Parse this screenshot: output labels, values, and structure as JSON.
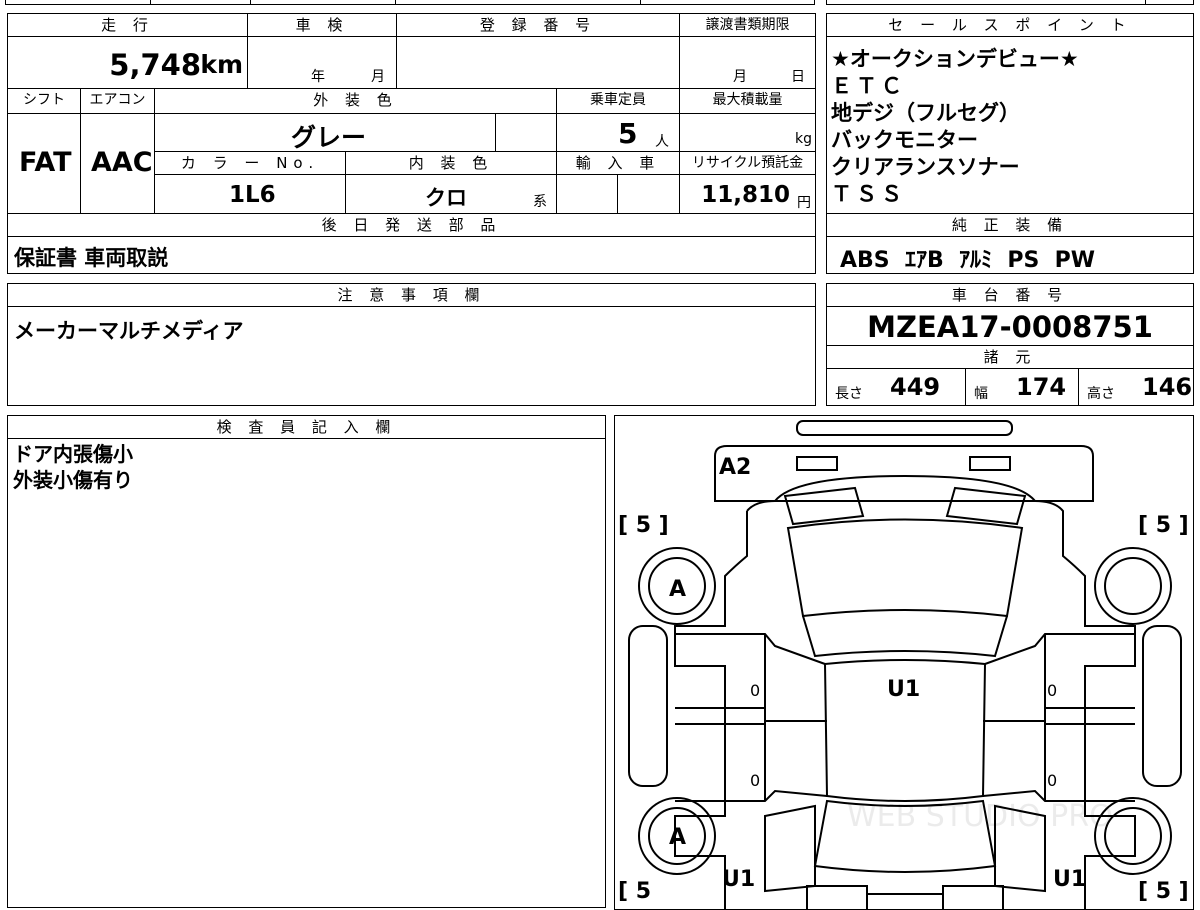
{
  "form": {
    "mileage_label": "走 行",
    "mileage_value": "5,748",
    "mileage_unit": "km",
    "inspection_label": "車 検",
    "inspection_year": "年",
    "inspection_month": "月",
    "registration_label": "登 録 番 号",
    "transfer_label": "譲渡書類期限",
    "transfer_month": "月",
    "transfer_day": "日",
    "shift_label": "シフト",
    "shift_value": "FAT",
    "ac_label": "エアコン",
    "ac_value": "AAC",
    "exterior_color_label": "外 装 色",
    "exterior_color_value": "グレー",
    "capacity_label": "乗車定員",
    "capacity_value": "5",
    "capacity_unit": "人",
    "max_load_label": "最大積載量",
    "max_load_unit": "kg",
    "color_no_label": "カ ラ ー No.",
    "color_no_value": "1L6",
    "interior_color_label": "内 装 色",
    "interior_color_value": "クロ",
    "interior_color_suffix": "系",
    "import_label": "輸 入 車",
    "recycle_label": "リサイクル預託金",
    "recycle_value": "11,810",
    "recycle_unit": "円",
    "later_parts_label": "後 日 発 送 部 品",
    "later_parts_value": "保証書 車両取説",
    "notes_label": "注 意 事 項 欄",
    "notes_value": "メーカーマルチメディア",
    "inspector_label": "検 査 員 記 入 欄",
    "inspector_lines": [
      "ドア内張傷小",
      "外装小傷有り"
    ]
  },
  "sales_points": {
    "label": "セ ー ル ス ポ イ ン ト",
    "items": [
      "★オークションデビュー★",
      "ＥＴＣ",
      "地デジ（フルセグ）",
      "バックモニター",
      "クリアランスソナー",
      "ＴＳＳ"
    ]
  },
  "equipment": {
    "label": "純 正 装 備",
    "value": "ABS  ｴｱB  ｱﾙﾐ  PS  PW"
  },
  "chassis": {
    "label": "車 台 番 号",
    "value": "MZEA17-0008751"
  },
  "specs": {
    "label": "諸 元",
    "length_label": "長さ",
    "length_value": "449",
    "width_label": "幅",
    "width_value": "174",
    "height_label": "高さ",
    "height_value": "146"
  },
  "diagram": {
    "front_code": "A2",
    "roof_code": "U1",
    "rear_left_code": "U1",
    "rear_right_code": "U1",
    "tire_fl_mark": "A",
    "tire_rl_mark": "A",
    "tread_fl": "[ 5 ]",
    "tread_fr": "[ 5 ]",
    "tread_rl": "[ 5",
    "tread_rr": "[ 5 ]",
    "door_marks": [
      "0",
      "0",
      "0",
      "0"
    ],
    "watermark": "WEB STUDIO PRO"
  }
}
